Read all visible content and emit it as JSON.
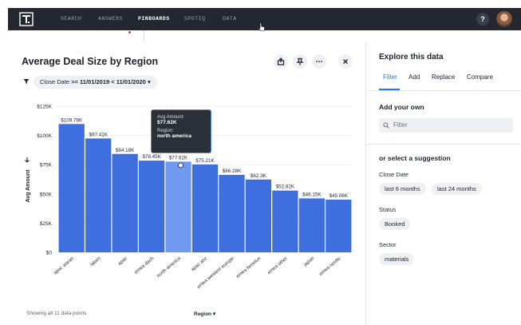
{
  "nav": {
    "items": [
      "SEARCH",
      "ANSWERS",
      "PINBOARDS",
      "SPOTIQ",
      "DATA"
    ],
    "active": "PINBOARDS",
    "help": "?"
  },
  "chart_header": {
    "title": "Average Deal Size by Region",
    "filter_field": "Close Date",
    "filter_value": ">= 11/01/2019 < 11/01/2020"
  },
  "chart_data": {
    "type": "bar",
    "categories": [
      "apac asean",
      "latam",
      "apac",
      "emea dach",
      "north america",
      "apac anz",
      "emea western europe",
      "emea benelux",
      "emea other",
      "japan",
      "emea nordic"
    ],
    "values": [
      109.78,
      97.41,
      84.18,
      78.45,
      77.62,
      75.21,
      66.28,
      62.3,
      52.82,
      46.15,
      45.06
    ],
    "data_labels": [
      "$109.78K",
      "$97.41K",
      "$84.18K",
      "$78.45K",
      "$77.62K",
      "$75.21K",
      "$66.28K",
      "$62.3K",
      "$52.82K",
      "$46.15K",
      "$45.06K"
    ],
    "ylabel": "Avg Amount",
    "ylim": [
      0,
      125
    ],
    "yticks": [
      0,
      25,
      50,
      75,
      100,
      125
    ],
    "ytick_labels": [
      "$0",
      "$25K",
      "$50K",
      "$75K",
      "$100K",
      "$125K"
    ],
    "highlight_index": 4,
    "bar_color": "#3f6fde",
    "highlight_color": "#6f9af0",
    "grid": true
  },
  "tooltip": {
    "metric_label": "Avg Amount:",
    "metric_value": "$77.62K",
    "dim_label": "Region:",
    "dim_value": "north america"
  },
  "footer": {
    "points": "Showing all 11 data points",
    "axis_selector": "Region"
  },
  "explore": {
    "title": "Explore this data",
    "tabs": [
      "Filter",
      "Add",
      "Replace",
      "Compare"
    ],
    "active_tab": "Filter",
    "add_own": "Add your own",
    "filter_placeholder": "Filter",
    "suggestion_heading": "or select a suggestion",
    "groups": [
      {
        "label": "Close Date",
        "chips": [
          "last 6 months",
          "last 24 months"
        ]
      },
      {
        "label": "Status",
        "chips": [
          "Booked"
        ]
      },
      {
        "label": "Sector",
        "chips": [
          "materials"
        ]
      }
    ]
  }
}
